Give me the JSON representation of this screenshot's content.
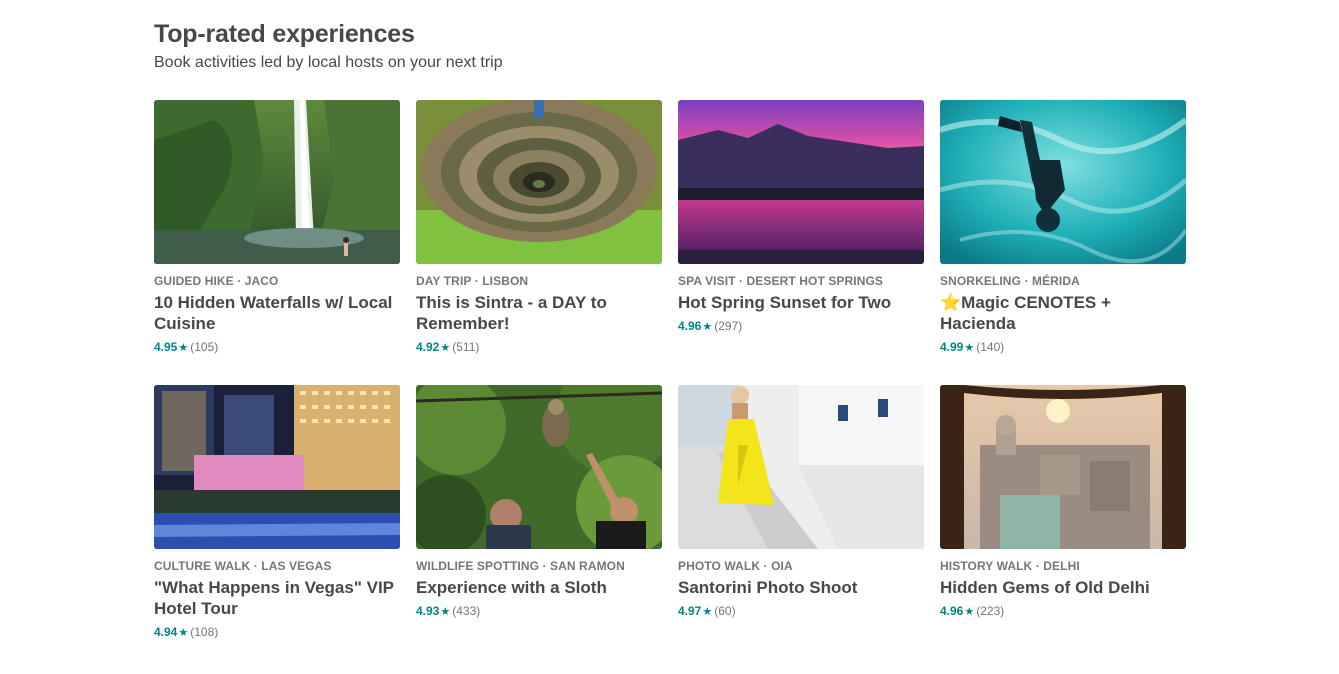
{
  "section": {
    "title": "Top-rated experiences",
    "subtitle": "Book activities led by local hosts on your next trip"
  },
  "colors": {
    "accent": "#008489",
    "text": "#484848",
    "muted": "#767676"
  },
  "experiences": [
    {
      "kicker": "GUIDED HIKE · JACO",
      "title": "10 Hidden Waterfalls w/ Local Cuisine",
      "rating": "4.95",
      "reviews": "(105)",
      "image": "waterfall-photo",
      "star_icon": "star-icon"
    },
    {
      "kicker": "DAY TRIP · LISBON",
      "title": "This is Sintra - a DAY to Remember!",
      "rating": "4.92",
      "reviews": "(511)",
      "image": "spiral-well-photo",
      "star_icon": "star-icon"
    },
    {
      "kicker": "SPA VISIT · DESERT HOT SPRINGS",
      "title": "Hot Spring Sunset for Two",
      "rating": "4.96",
      "reviews": "(297)",
      "image": "sunset-pool-photo",
      "star_icon": "star-icon"
    },
    {
      "kicker": "SNORKELING · MÉRIDA",
      "title": "⭐Magic CENOTES + Hacienda",
      "rating": "4.99",
      "reviews": "(140)",
      "image": "cenote-diver-photo",
      "star_icon": "star-icon"
    },
    {
      "kicker": "CULTURE WALK · LAS VEGAS",
      "title": "\"What Happens in Vegas\" VIP Hotel Tour",
      "rating": "4.94",
      "reviews": "(108)",
      "image": "vegas-night-photo",
      "star_icon": "star-icon"
    },
    {
      "kicker": "WILDLIFE SPOTTING · SAN RAMON",
      "title": "Experience with a Sloth",
      "rating": "4.93",
      "reviews": "(433)",
      "image": "sloth-photo",
      "star_icon": "star-icon"
    },
    {
      "kicker": "PHOTO WALK · OIA",
      "title": "Santorini Photo Shoot",
      "rating": "4.97",
      "reviews": "(60)",
      "image": "santorini-photo",
      "star_icon": "star-icon"
    },
    {
      "kicker": "HISTORY WALK · DELHI",
      "title": "Hidden Gems of Old Delhi",
      "rating": "4.96",
      "reviews": "(223)",
      "image": "old-delhi-photo",
      "star_icon": "star-icon"
    }
  ]
}
